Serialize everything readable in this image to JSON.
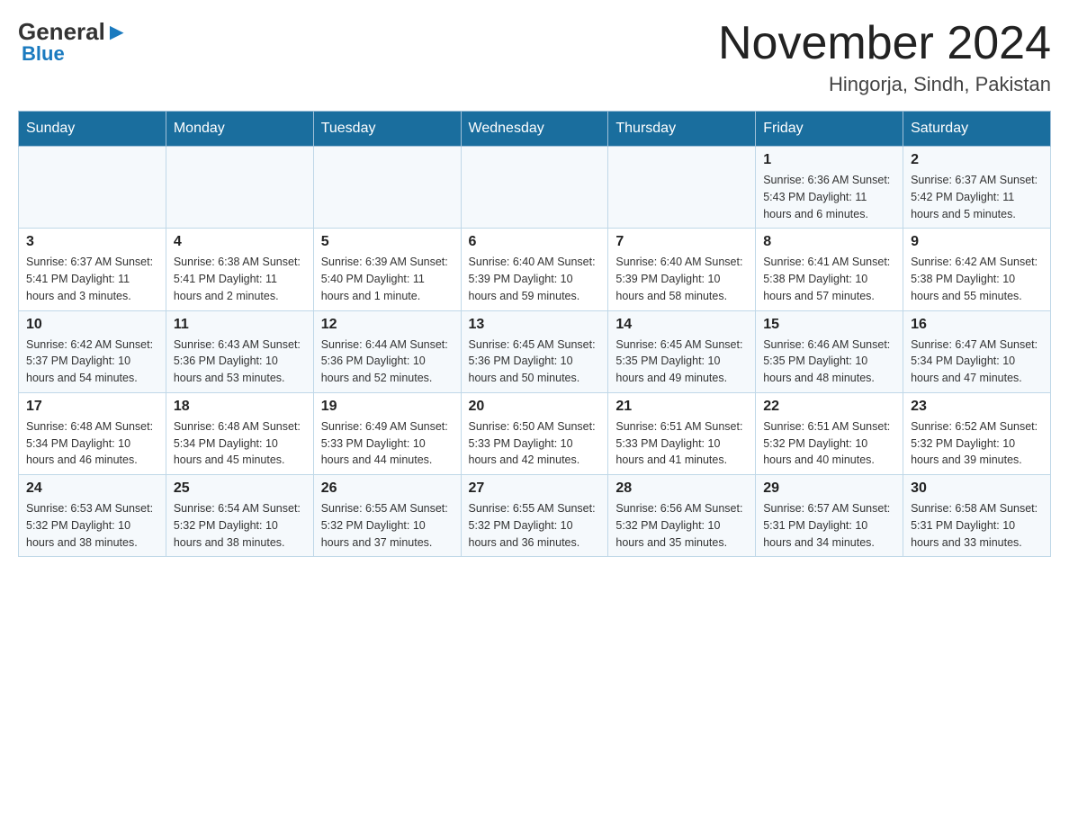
{
  "header": {
    "logo_general": "General",
    "logo_blue": "Blue",
    "month_title": "November 2024",
    "location": "Hingorja, Sindh, Pakistan"
  },
  "weekdays": [
    "Sunday",
    "Monday",
    "Tuesday",
    "Wednesday",
    "Thursday",
    "Friday",
    "Saturday"
  ],
  "weeks": [
    [
      {
        "day": "",
        "info": ""
      },
      {
        "day": "",
        "info": ""
      },
      {
        "day": "",
        "info": ""
      },
      {
        "day": "",
        "info": ""
      },
      {
        "day": "",
        "info": ""
      },
      {
        "day": "1",
        "info": "Sunrise: 6:36 AM\nSunset: 5:43 PM\nDaylight: 11 hours and 6 minutes."
      },
      {
        "day": "2",
        "info": "Sunrise: 6:37 AM\nSunset: 5:42 PM\nDaylight: 11 hours and 5 minutes."
      }
    ],
    [
      {
        "day": "3",
        "info": "Sunrise: 6:37 AM\nSunset: 5:41 PM\nDaylight: 11 hours and 3 minutes."
      },
      {
        "day": "4",
        "info": "Sunrise: 6:38 AM\nSunset: 5:41 PM\nDaylight: 11 hours and 2 minutes."
      },
      {
        "day": "5",
        "info": "Sunrise: 6:39 AM\nSunset: 5:40 PM\nDaylight: 11 hours and 1 minute."
      },
      {
        "day": "6",
        "info": "Sunrise: 6:40 AM\nSunset: 5:39 PM\nDaylight: 10 hours and 59 minutes."
      },
      {
        "day": "7",
        "info": "Sunrise: 6:40 AM\nSunset: 5:39 PM\nDaylight: 10 hours and 58 minutes."
      },
      {
        "day": "8",
        "info": "Sunrise: 6:41 AM\nSunset: 5:38 PM\nDaylight: 10 hours and 57 minutes."
      },
      {
        "day": "9",
        "info": "Sunrise: 6:42 AM\nSunset: 5:38 PM\nDaylight: 10 hours and 55 minutes."
      }
    ],
    [
      {
        "day": "10",
        "info": "Sunrise: 6:42 AM\nSunset: 5:37 PM\nDaylight: 10 hours and 54 minutes."
      },
      {
        "day": "11",
        "info": "Sunrise: 6:43 AM\nSunset: 5:36 PM\nDaylight: 10 hours and 53 minutes."
      },
      {
        "day": "12",
        "info": "Sunrise: 6:44 AM\nSunset: 5:36 PM\nDaylight: 10 hours and 52 minutes."
      },
      {
        "day": "13",
        "info": "Sunrise: 6:45 AM\nSunset: 5:36 PM\nDaylight: 10 hours and 50 minutes."
      },
      {
        "day": "14",
        "info": "Sunrise: 6:45 AM\nSunset: 5:35 PM\nDaylight: 10 hours and 49 minutes."
      },
      {
        "day": "15",
        "info": "Sunrise: 6:46 AM\nSunset: 5:35 PM\nDaylight: 10 hours and 48 minutes."
      },
      {
        "day": "16",
        "info": "Sunrise: 6:47 AM\nSunset: 5:34 PM\nDaylight: 10 hours and 47 minutes."
      }
    ],
    [
      {
        "day": "17",
        "info": "Sunrise: 6:48 AM\nSunset: 5:34 PM\nDaylight: 10 hours and 46 minutes."
      },
      {
        "day": "18",
        "info": "Sunrise: 6:48 AM\nSunset: 5:34 PM\nDaylight: 10 hours and 45 minutes."
      },
      {
        "day": "19",
        "info": "Sunrise: 6:49 AM\nSunset: 5:33 PM\nDaylight: 10 hours and 44 minutes."
      },
      {
        "day": "20",
        "info": "Sunrise: 6:50 AM\nSunset: 5:33 PM\nDaylight: 10 hours and 42 minutes."
      },
      {
        "day": "21",
        "info": "Sunrise: 6:51 AM\nSunset: 5:33 PM\nDaylight: 10 hours and 41 minutes."
      },
      {
        "day": "22",
        "info": "Sunrise: 6:51 AM\nSunset: 5:32 PM\nDaylight: 10 hours and 40 minutes."
      },
      {
        "day": "23",
        "info": "Sunrise: 6:52 AM\nSunset: 5:32 PM\nDaylight: 10 hours and 39 minutes."
      }
    ],
    [
      {
        "day": "24",
        "info": "Sunrise: 6:53 AM\nSunset: 5:32 PM\nDaylight: 10 hours and 38 minutes."
      },
      {
        "day": "25",
        "info": "Sunrise: 6:54 AM\nSunset: 5:32 PM\nDaylight: 10 hours and 38 minutes."
      },
      {
        "day": "26",
        "info": "Sunrise: 6:55 AM\nSunset: 5:32 PM\nDaylight: 10 hours and 37 minutes."
      },
      {
        "day": "27",
        "info": "Sunrise: 6:55 AM\nSunset: 5:32 PM\nDaylight: 10 hours and 36 minutes."
      },
      {
        "day": "28",
        "info": "Sunrise: 6:56 AM\nSunset: 5:32 PM\nDaylight: 10 hours and 35 minutes."
      },
      {
        "day": "29",
        "info": "Sunrise: 6:57 AM\nSunset: 5:31 PM\nDaylight: 10 hours and 34 minutes."
      },
      {
        "day": "30",
        "info": "Sunrise: 6:58 AM\nSunset: 5:31 PM\nDaylight: 10 hours and 33 minutes."
      }
    ]
  ]
}
